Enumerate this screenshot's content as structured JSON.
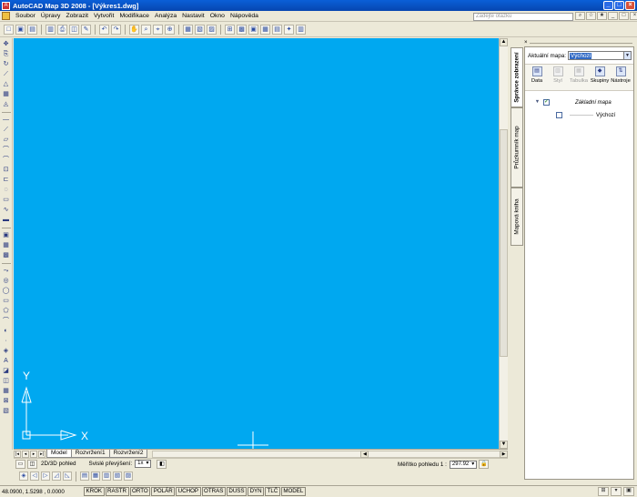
{
  "window": {
    "title": "AutoCAD Map 3D 2008 - [Výkres1.dwg]",
    "app_icon": "A",
    "controls": [
      "_",
      "□",
      "×"
    ]
  },
  "menu": {
    "items": [
      "Soubor",
      "Úpravy",
      "Zobrazit",
      "Vytvořit",
      "Modifikace",
      "Analýza",
      "Nastavit",
      "Okno",
      "Nápověda"
    ],
    "search_placeholder": "Zadejte otázku",
    "right_buttons": [
      "⌕",
      "☆",
      "★",
      "_",
      "□",
      "×"
    ]
  },
  "toolbar": {
    "buttons": [
      "□",
      "▣",
      "▤",
      "▥",
      "⎙",
      "◫",
      "✎",
      "↶",
      "↷",
      "✋",
      "⌕",
      "⌖",
      "⊕",
      "▦",
      "▧",
      "▨",
      "⊞",
      "▩",
      "▣",
      "▦",
      "▤",
      "✦",
      "▥"
    ]
  },
  "left_toolbar": {
    "buttons": [
      "✥",
      "⎘",
      "↻",
      "⟋",
      "△",
      "▦",
      "◬",
      "—",
      "⟋",
      "▱",
      "⌒",
      "⌒",
      "⊡",
      "⊏",
      "◌",
      "▭",
      "∿",
      "▬",
      "▣",
      "▦",
      "▩",
      "⤳",
      "◎",
      "◯",
      "▭",
      "⬠",
      "⌒",
      "◐",
      "·",
      "◈",
      "A",
      "◪",
      "◫",
      "▦",
      "⊠",
      "▧"
    ]
  },
  "drawing": {
    "axis_y": "Y",
    "axis_x": "X",
    "background": "#00a8f0"
  },
  "tabs": {
    "nav": [
      "|◂",
      "◂",
      "▸",
      "▸|"
    ],
    "items": [
      "Model",
      "Rozvržení1",
      "Rozvržení2"
    ],
    "active_index": 0
  },
  "drawing_status": {
    "view_label": "2D/3D pohled",
    "exaggeration_label": "Svislé převýšení:",
    "exaggeration_value": "1x",
    "scale_label": "Měřítko pohledu 1 :",
    "scale_value": "297.92"
  },
  "bottom_toolbar": {
    "buttons": [
      "◈",
      "◁",
      "▷",
      "◿",
      "◺",
      "▤",
      "▦",
      "▥",
      "▧",
      "▨"
    ]
  },
  "status": {
    "coords": "48.0900, 1.5298 , 0.0000",
    "toggles": [
      "KROK",
      "RASTR",
      "ORTO",
      "POLÁR",
      "UCHOP",
      "OTRAS",
      "DUSS",
      "DYN",
      "TLČ",
      "MODEL"
    ],
    "right_buttons": [
      "⊞",
      "▾",
      "▣"
    ]
  },
  "right_panel": {
    "vertical_tabs": [
      "Správce zobrazení",
      "Průzkumník map",
      "Mapová kniha"
    ],
    "active_tab": 0,
    "current_map_label": "Aktuální mapa:",
    "current_map_value": "Výchozí",
    "tools": [
      {
        "icon": "data-icon",
        "glyph": "▤",
        "label": "Data",
        "disabled": false
      },
      {
        "icon": "style-icon",
        "glyph": "▥",
        "label": "Styl",
        "disabled": true
      },
      {
        "icon": "table-icon",
        "glyph": "▦",
        "label": "Tabulka",
        "disabled": true
      },
      {
        "icon": "groups-icon",
        "glyph": "◆",
        "label": "Skupiny",
        "disabled": false
      },
      {
        "icon": "tools-icon",
        "glyph": "⇅",
        "label": "Nástroje",
        "disabled": false
      }
    ],
    "tree": {
      "root_label": "Základní mapa",
      "root_checked": true,
      "child_label": "Výchozí",
      "child_checked": false
    }
  }
}
